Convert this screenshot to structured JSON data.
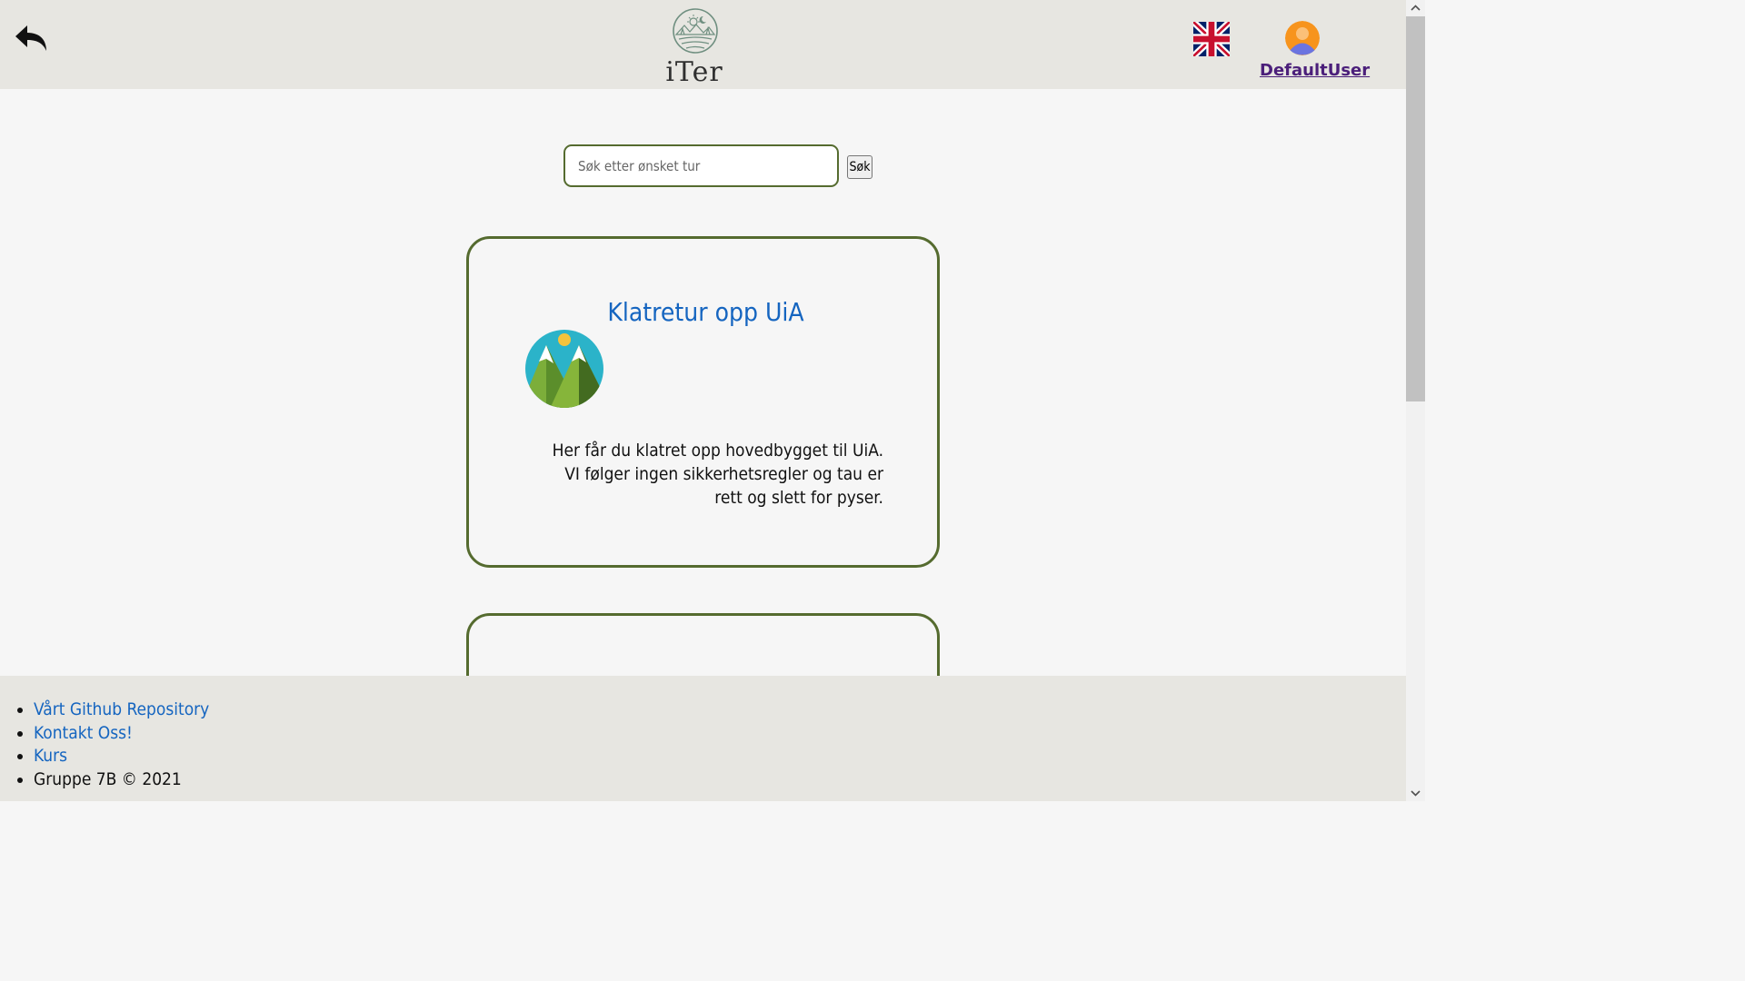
{
  "header": {
    "logo_text": "iTer",
    "language_flag": "uk-flag-icon",
    "username": "DefaultUser"
  },
  "search": {
    "placeholder": "Søk etter ønsket tur",
    "value": "",
    "button_label": "Søk"
  },
  "cards": [
    {
      "title": "Klatretur opp UiA",
      "image_icon": "mountain-landscape-icon",
      "description": "Her får du klatret opp hovedbygget til UiA. VI følger ingen sikkerhetsregler og tau er rett og slett for pyser."
    }
  ],
  "footer": {
    "links": [
      {
        "label": "Vårt Github Repository"
      },
      {
        "label": "Kontakt Oss!"
      },
      {
        "label": "Kurs"
      }
    ],
    "copyright": "Gruppe 7B © 2021"
  },
  "colors": {
    "accent_green": "#556b2f",
    "link_blue": "#1565c0",
    "header_bg": "#e7e6e1",
    "user_link": "#4b1f7a"
  }
}
